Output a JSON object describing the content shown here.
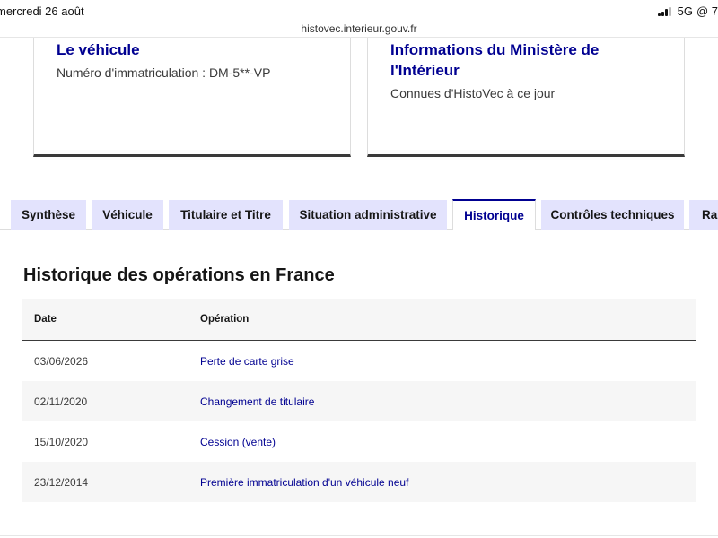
{
  "status_bar": {
    "date": "mercredi 26 août",
    "network": "5G",
    "indicator": "@ 7"
  },
  "browser": {
    "url": "histovec.interieur.gouv.fr"
  },
  "cards": [
    {
      "title": "Le véhicule",
      "text": "Numéro d'immatriculation : DM-5**-VP"
    },
    {
      "title": "Informations du Ministère de l'Intérieur",
      "text": "Connues d'HistoVec à ce jour"
    }
  ],
  "tabs": [
    {
      "label": "Synthèse",
      "active": false
    },
    {
      "label": "Véhicule",
      "active": false
    },
    {
      "label": "Titulaire et Titre",
      "active": false
    },
    {
      "label": "Situation administrative",
      "active": false
    },
    {
      "label": "Historique",
      "active": true
    },
    {
      "label": "Contrôles techniques",
      "active": false
    },
    {
      "label": "Rap",
      "active": false
    }
  ],
  "history": {
    "title": "Historique des opérations en France",
    "columns": {
      "date": "Date",
      "operation": "Opération"
    },
    "rows": [
      {
        "date": "03/06/2026",
        "operation": "Perte de carte grise"
      },
      {
        "date": "02/11/2020",
        "operation": "Changement de titulaire"
      },
      {
        "date": "15/10/2020",
        "operation": "Cession (vente)"
      },
      {
        "date": "23/12/2014",
        "operation": "Première immatriculation d'un véhicule neuf"
      }
    ]
  },
  "colors": {
    "accent": "#000091",
    "tab_bg": "#e3e3fd",
    "row_alt": "#f6f6f6"
  }
}
